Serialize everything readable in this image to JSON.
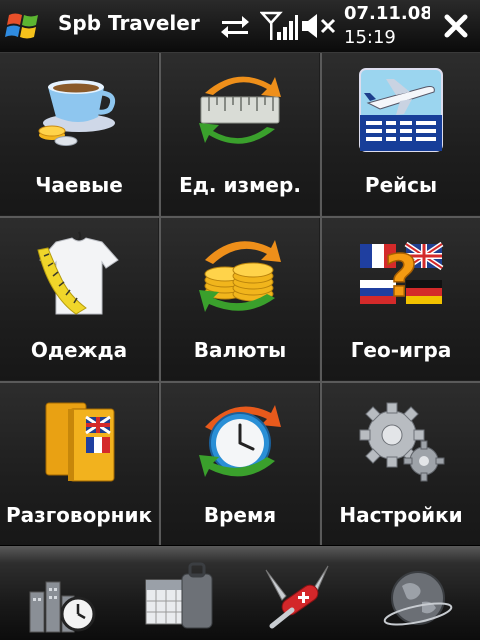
{
  "statusbar": {
    "app_title": "Spb Traveler",
    "date": "07.11.08",
    "time": "15:19",
    "icons": [
      "windows-start-icon",
      "sync-icon",
      "signal-icon",
      "volume-muted-icon",
      "close-icon"
    ]
  },
  "tiles": [
    {
      "label": "Чаевые",
      "icon": "tea-cup-coins-icon"
    },
    {
      "label": "Ед. измер.",
      "icon": "ruler-convert-icon"
    },
    {
      "label": "Рейсы",
      "icon": "airplane-flights-icon"
    },
    {
      "label": "Одежда",
      "icon": "shirt-measure-icon"
    },
    {
      "label": "Валюты",
      "icon": "coins-exchange-icon"
    },
    {
      "label": "Гео-игра",
      "icon": "flags-quiz-icon"
    },
    {
      "label": "Разговорник",
      "icon": "phrasebook-icon"
    },
    {
      "label": "Время",
      "icon": "clock-icon"
    },
    {
      "label": "Настройки",
      "icon": "gears-icon"
    }
  ],
  "dock": {
    "icons": [
      "city-clock-icon",
      "calendar-luggage-icon",
      "swiss-knife-icon",
      "globe-icon"
    ]
  },
  "colors": {
    "grid_background": "#1e1e1e",
    "grid_line": "#5a5a5a",
    "accent_orange": "#f2a21a",
    "accent_green": "#3aa02c",
    "text": "#ffffff"
  }
}
